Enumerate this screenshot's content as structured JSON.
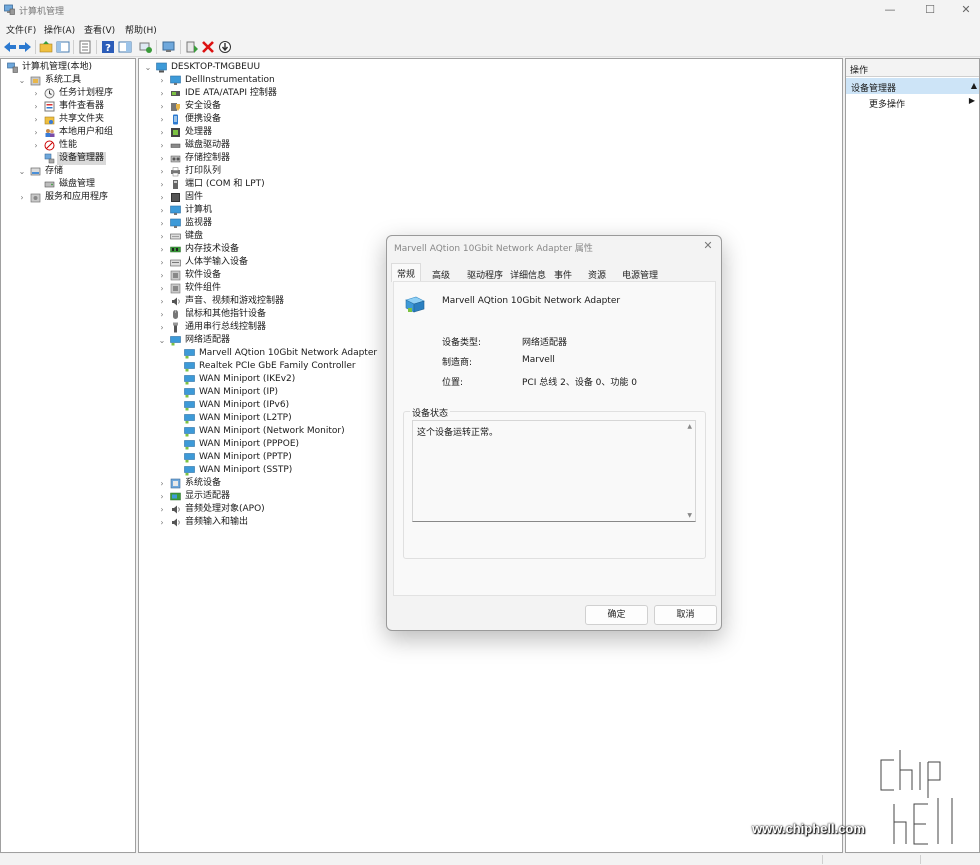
{
  "window": {
    "title": "计算机管理"
  },
  "menu": [
    "文件(F)",
    "操作(A)",
    "查看(V)",
    "帮助(H)"
  ],
  "left_tree": [
    {
      "label": "计算机管理(本地)",
      "indent": 0,
      "chev": "",
      "icon": "computer-management-icon"
    },
    {
      "label": "系统工具",
      "indent": 1,
      "chev": "⌄",
      "icon": "system-tools-icon"
    },
    {
      "label": "任务计划程序",
      "indent": 2,
      "chev": "›",
      "icon": "clock-icon"
    },
    {
      "label": "事件查看器",
      "indent": 2,
      "chev": "›",
      "icon": "event-viewer-icon"
    },
    {
      "label": "共享文件夹",
      "indent": 2,
      "chev": "›",
      "icon": "shared-folder-icon"
    },
    {
      "label": "本地用户和组",
      "indent": 2,
      "chev": "›",
      "icon": "users-icon"
    },
    {
      "label": "性能",
      "indent": 2,
      "chev": "›",
      "icon": "performance-icon"
    },
    {
      "label": "设备管理器",
      "indent": 2,
      "chev": "",
      "icon": "device-manager-icon",
      "selected": true
    },
    {
      "label": "存储",
      "indent": 1,
      "chev": "⌄",
      "icon": "storage-icon"
    },
    {
      "label": "磁盘管理",
      "indent": 2,
      "chev": "",
      "icon": "disk-icon"
    },
    {
      "label": "服务和应用程序",
      "indent": 1,
      "chev": "›",
      "icon": "services-icon"
    }
  ],
  "device_tree": {
    "root": "DESKTOP-TMGBEUU",
    "categories": [
      {
        "label": "DellInstrumentation",
        "chev": "›",
        "icon": "monitor-icon"
      },
      {
        "label": "IDE ATA/ATAPI 控制器",
        "chev": "›",
        "icon": "ide-icon"
      },
      {
        "label": "安全设备",
        "chev": "›",
        "icon": "security-icon"
      },
      {
        "label": "便携设备",
        "chev": "›",
        "icon": "portable-icon"
      },
      {
        "label": "处理器",
        "chev": "›",
        "icon": "cpu-icon"
      },
      {
        "label": "磁盘驱动器",
        "chev": "›",
        "icon": "disk-drive-icon"
      },
      {
        "label": "存储控制器",
        "chev": "›",
        "icon": "storage-controller-icon"
      },
      {
        "label": "打印队列",
        "chev": "›",
        "icon": "printer-icon"
      },
      {
        "label": "端口 (COM 和 LPT)",
        "chev": "›",
        "icon": "port-icon"
      },
      {
        "label": "固件",
        "chev": "›",
        "icon": "firmware-icon"
      },
      {
        "label": "计算机",
        "chev": "›",
        "icon": "monitor-icon"
      },
      {
        "label": "监视器",
        "chev": "›",
        "icon": "monitor-icon"
      },
      {
        "label": "键盘",
        "chev": "›",
        "icon": "keyboard-icon"
      },
      {
        "label": "内存技术设备",
        "chev": "›",
        "icon": "memory-icon"
      },
      {
        "label": "人体学输入设备",
        "chev": "›",
        "icon": "hid-icon"
      },
      {
        "label": "软件设备",
        "chev": "›",
        "icon": "software-icon"
      },
      {
        "label": "软件组件",
        "chev": "›",
        "icon": "software-icon"
      },
      {
        "label": "声音、视频和游戏控制器",
        "chev": "›",
        "icon": "speaker-icon"
      },
      {
        "label": "鼠标和其他指针设备",
        "chev": "›",
        "icon": "mouse-icon"
      },
      {
        "label": "通用串行总线控制器",
        "chev": "›",
        "icon": "usb-icon"
      },
      {
        "label": "网络适配器",
        "chev": "⌄",
        "icon": "network-adapter-icon",
        "children": [
          "Marvell AQtion 10Gbit Network Adapter",
          "Realtek PCIe GbE Family Controller",
          "WAN Miniport (IKEv2)",
          "WAN Miniport (IP)",
          "WAN Miniport (IPv6)",
          "WAN Miniport (L2TP)",
          "WAN Miniport (Network Monitor)",
          "WAN Miniport (PPPOE)",
          "WAN Miniport (PPTP)",
          "WAN Miniport (SSTP)"
        ]
      },
      {
        "label": "系统设备",
        "chev": "›",
        "icon": "system-device-icon"
      },
      {
        "label": "显示适配器",
        "chev": "›",
        "icon": "display-adapter-icon"
      },
      {
        "label": "音频处理对象(APO)",
        "chev": "›",
        "icon": "speaker-icon"
      },
      {
        "label": "音频输入和输出",
        "chev": "›",
        "icon": "speaker-icon"
      }
    ]
  },
  "actions": {
    "header": "操作",
    "section": "设备管理器",
    "more": "更多操作"
  },
  "dialog": {
    "title": "Marvell AQtion 10Gbit Network Adapter 属性",
    "tabs": [
      "常规",
      "高级",
      "驱动程序",
      "详细信息",
      "事件",
      "资源",
      "电源管理"
    ],
    "device_name": "Marvell AQtion 10Gbit Network Adapter",
    "props": [
      {
        "label": "设备类型:",
        "value": "网络适配器"
      },
      {
        "label": "制造商:",
        "value": "Marvell"
      },
      {
        "label": "位置:",
        "value": "PCI 总线 2、设备 0、功能 0"
      }
    ],
    "status_group": "设备状态",
    "status_text": "这个设备运转正常。",
    "ok": "确定",
    "cancel": "取消"
  },
  "watermark": {
    "url": "www.chiphell.com",
    "logo_text": "chip hell"
  },
  "colors": {
    "accent_blue": "#2b79d0",
    "selection": "#cde4f7"
  }
}
